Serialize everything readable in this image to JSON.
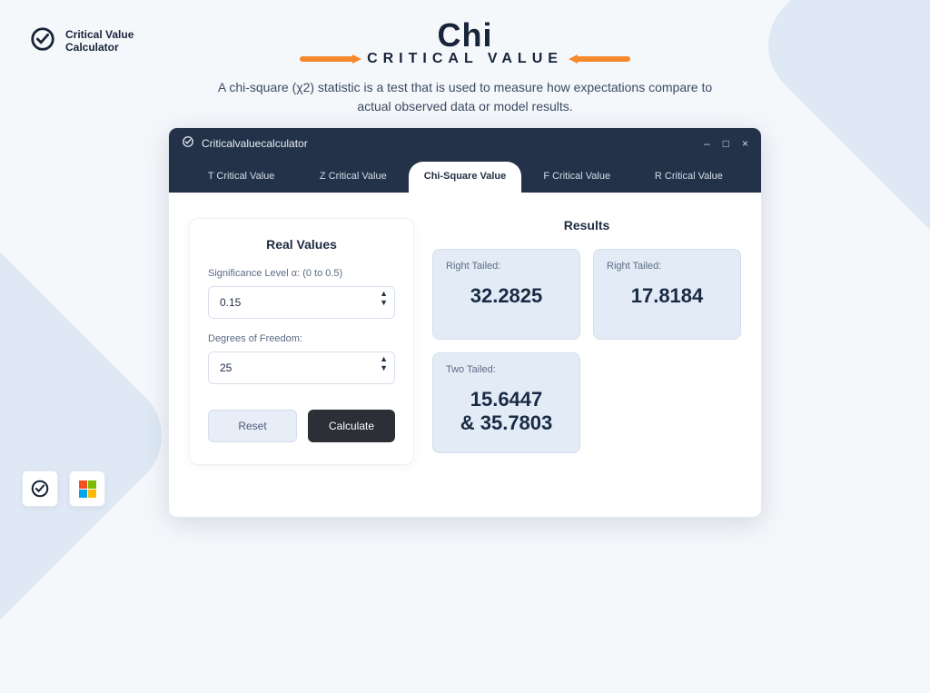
{
  "brand": {
    "line1": "Critical Value",
    "line2": "Calculator"
  },
  "hero": {
    "title": "Chi",
    "subtitle": "CRITICAL VALUE",
    "description": "A chi-square (χ2) statistic is a test that is used to measure how expectations compare to actual observed data or model results."
  },
  "window": {
    "title": "Criticalvaluecalculator",
    "controls": {
      "min": "–",
      "max": "□",
      "close": "×"
    }
  },
  "tabs": [
    {
      "label": "T Critical Value",
      "active": false
    },
    {
      "label": "Z Critical Value",
      "active": false
    },
    {
      "label": "Chi-Square Value",
      "active": true
    },
    {
      "label": "F Critical Value",
      "active": false
    },
    {
      "label": "R Critical Value",
      "active": false
    }
  ],
  "inputs_panel": {
    "title": "Real Values",
    "alpha_label": "Significance Level α: (0 to 0.5)",
    "alpha_value": "0.15",
    "dof_label": "Degrees of Freedom:",
    "dof_value": "25",
    "reset": "Reset",
    "calculate": "Calculate"
  },
  "results_panel": {
    "title": "Results",
    "boxes": [
      {
        "label": "Right Tailed:",
        "value": "32.2825"
      },
      {
        "label": "Right Tailed:",
        "value": "17.8184"
      },
      {
        "label": "Two Tailed:",
        "value": "15.6447\n& 35.7803"
      }
    ]
  },
  "colors": {
    "header_bg": "#233149",
    "accent_orange": "#f5892b",
    "result_bg": "#e3ecf6"
  }
}
